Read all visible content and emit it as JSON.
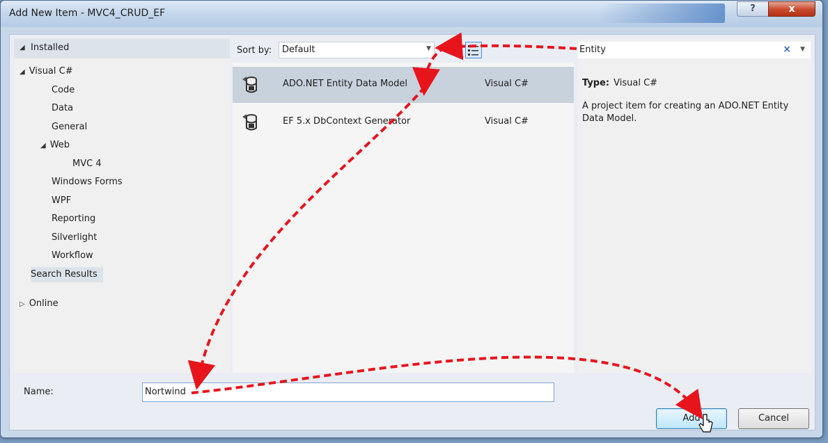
{
  "window": {
    "title": "Add New Item - MVC4_CRUD_EF",
    "help_label": "?",
    "close_label": "x"
  },
  "left_pane": {
    "installed_label": "Installed",
    "tree": [
      {
        "label": "Visual C#",
        "level": 0,
        "expander": "expanded"
      },
      {
        "label": "Code",
        "level": 1
      },
      {
        "label": "Data",
        "level": 1
      },
      {
        "label": "General",
        "level": 1
      },
      {
        "label": "Web",
        "level": 1,
        "expander": "expanded"
      },
      {
        "label": "MVC 4",
        "level": 2
      },
      {
        "label": "Windows Forms",
        "level": 1
      },
      {
        "label": "WPF",
        "level": 1
      },
      {
        "label": "Reporting",
        "level": 1
      },
      {
        "label": "Silverlight",
        "level": 1
      },
      {
        "label": "Workflow",
        "level": 1
      },
      {
        "label": "Search Results",
        "level": 0,
        "selected": true
      },
      {
        "label": "Online",
        "level": 0,
        "expander": "collapsed"
      }
    ]
  },
  "toolbar": {
    "sort_by_label": "Sort by:",
    "sort_by_value": "Default"
  },
  "templates": [
    {
      "name": "ADO.NET Entity Data Model",
      "language": "Visual C#",
      "selected": true,
      "icon": "entity-model-icon"
    },
    {
      "name": "EF 5.x DbContext Generator",
      "language": "Visual C#",
      "selected": false,
      "icon": "dbcontext-generator-icon"
    }
  ],
  "search": {
    "value": "Entity",
    "clear_label": "×"
  },
  "details": {
    "type_label": "Type:",
    "type_value": "Visual C#",
    "description": "A project item for creating an ADO.NET Entity Data Model."
  },
  "name_field": {
    "label": "Name:",
    "value": "Nortwind"
  },
  "buttons": {
    "add_label": "Add",
    "cancel_label": "Cancel"
  },
  "colors": {
    "annotation_arrow": "#e8141c",
    "selection": "#c8d2dd",
    "accent": "#3c7fb1"
  }
}
